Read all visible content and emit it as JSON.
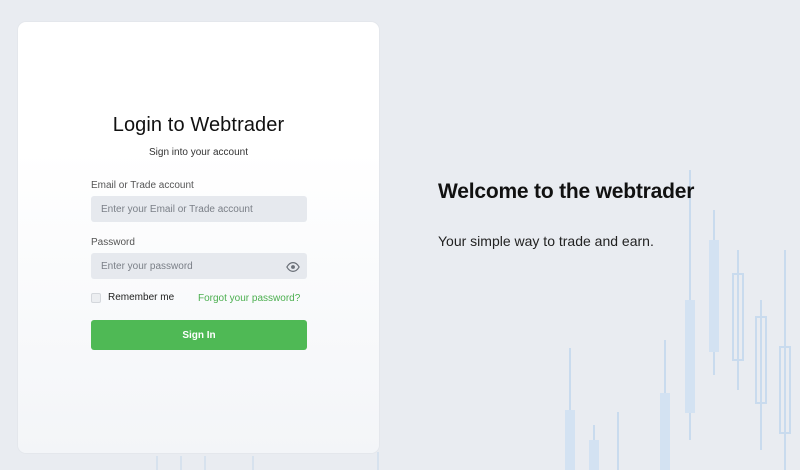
{
  "login": {
    "title": "Login to Webtrader",
    "subtitle": "Sign into your account",
    "email_label": "Email or Trade account",
    "email_placeholder": "Enter your Email or Trade account",
    "password_label": "Password",
    "password_placeholder": "Enter your password",
    "remember_label": "Remember me",
    "forgot_link": "Forgot your password?",
    "signin_label": "Sign In"
  },
  "hero": {
    "heading": "Welcome to the webtrader",
    "tagline": "Your simple way to trade and earn."
  },
  "colors": {
    "background": "#e9ecf1",
    "accent": "#4fb955",
    "link": "#4caf50",
    "input_bg": "#e6e9ee",
    "candle_fill": "#cfe0f1",
    "candle_stroke": "#c9dbee"
  },
  "icons": {
    "password_toggle": "eye-icon"
  }
}
